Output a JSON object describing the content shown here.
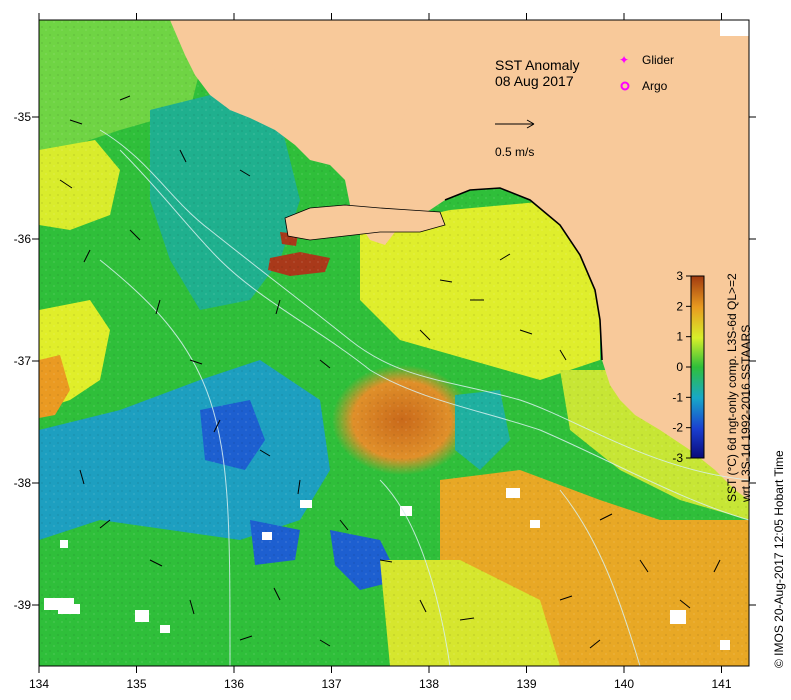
{
  "map": {
    "title": "SST Anomaly",
    "date": "08 Aug 2017",
    "scale_label": "0.5 m/s",
    "colors": {
      "land": "#f8c99a",
      "ocean_green": "#2fbf3a",
      "ocean_light": "#7dd84a",
      "ocean_yellow": "#e6ef2a",
      "ocean_cyan": "#16a7a8",
      "ocean_blue": "#1d6fd0",
      "ocean_orange": "#e69a1e",
      "ocean_red": "#b85a10",
      "cloud": "#ffffff",
      "coast": "#000000"
    }
  },
  "legend": {
    "glider_label": "Glider",
    "argo_label": "Argo",
    "glider_color": "#ff00ff",
    "argo_color": "#ff00ff"
  },
  "colorbar": {
    "ticks": [
      "3",
      "2",
      "1",
      "0",
      "-1",
      "-2",
      "-3"
    ],
    "label_line1": "SST (°C) 6d ngt-only comp. L3S-6d QL>=2",
    "label_line2": "wrt L3S-1d 1992-2016 SSTAARS",
    "colors": [
      "#0a0a7a",
      "#1a3fd0",
      "#18a8c8",
      "#2fbf3a",
      "#d8ef2a",
      "#e89a20",
      "#a13a10"
    ]
  },
  "axes": {
    "x_ticks": [
      "134",
      "135",
      "136",
      "137",
      "138",
      "139",
      "140",
      "141"
    ],
    "y_ticks": [
      "-35",
      "-36",
      "-37",
      "-38",
      "-39"
    ]
  },
  "credit": "© IMOS 20-Aug-2017 12:05 Hobart Time"
}
